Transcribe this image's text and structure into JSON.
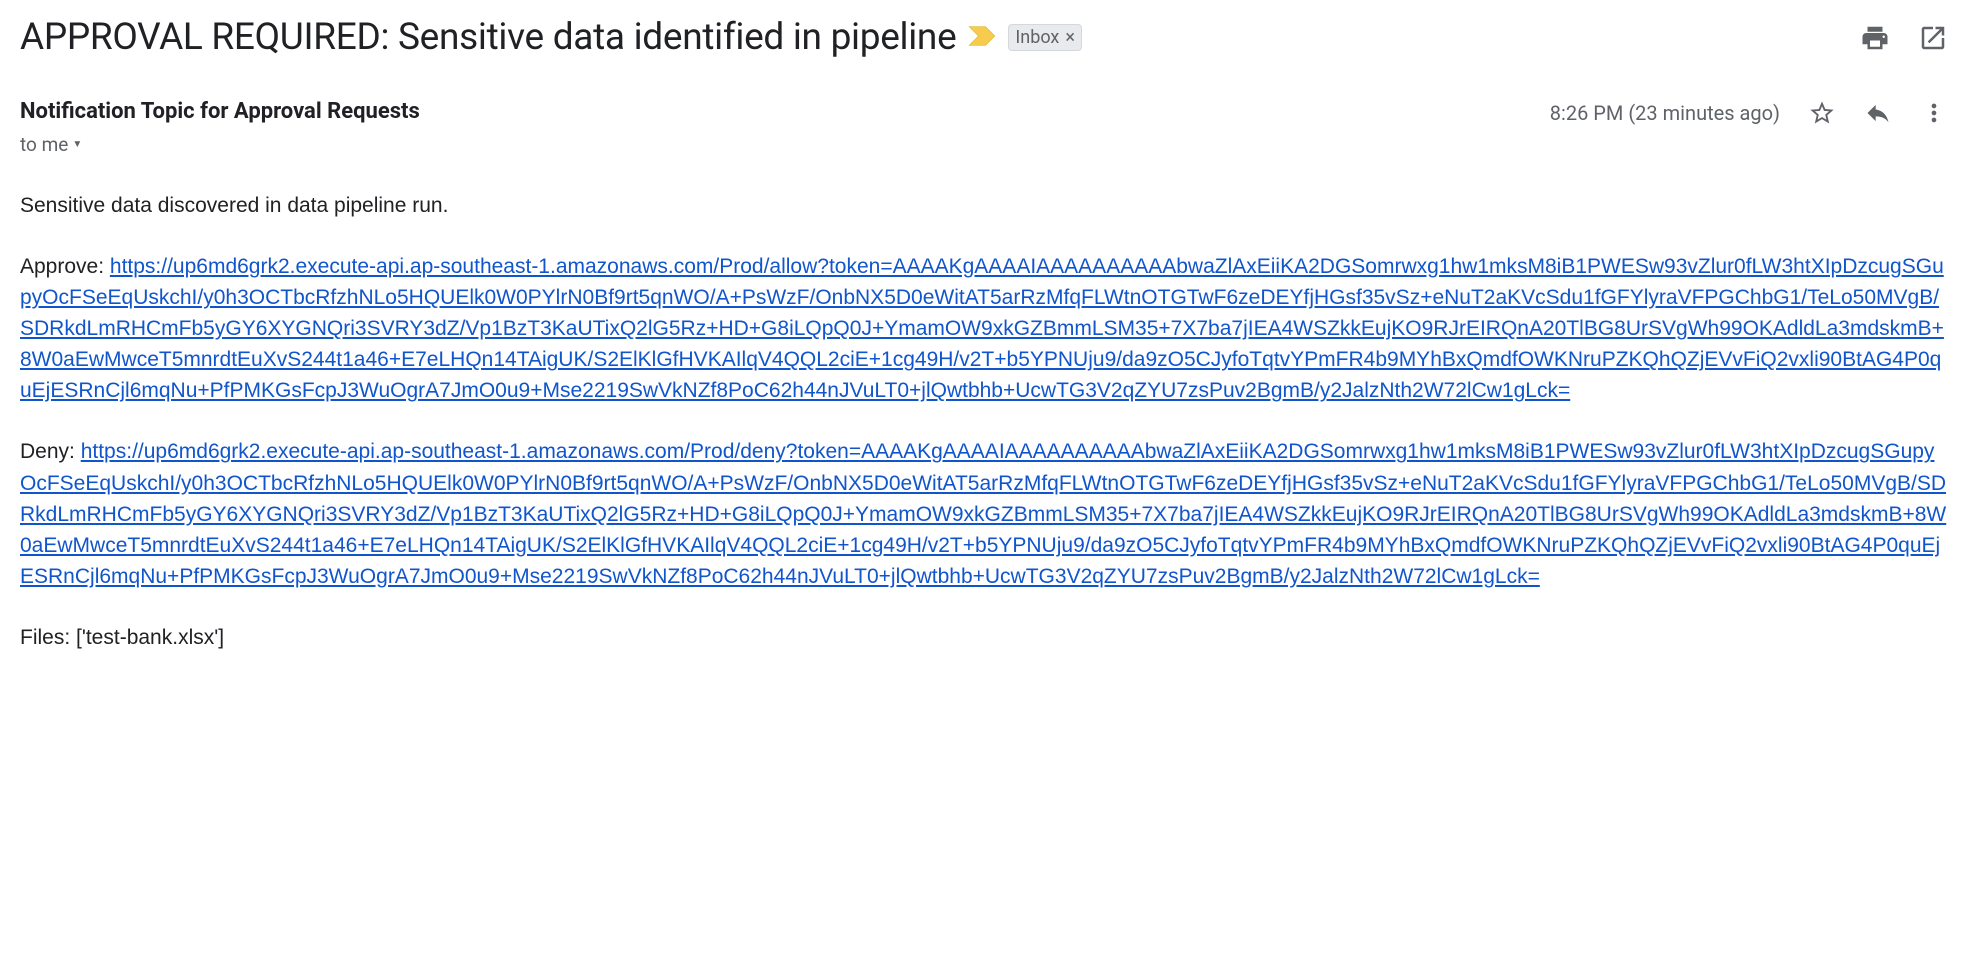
{
  "header": {
    "subject": "APPROVAL REQUIRED: Sensitive data identified in pipeline",
    "inbox_label": "Inbox"
  },
  "meta": {
    "sender": "Notification Topic for Approval Requests",
    "timestamp": "8:26 PM (23 minutes ago)",
    "to_line": "to me"
  },
  "body": {
    "intro": "Sensitive data discovered in data pipeline run.",
    "approve_label": "Approve: ",
    "approve_url": "https://up6md6grk2.execute-api.ap-southeast-1.amazonaws.com/Prod/allow?token=AAAAKgAAAAIAAAAAAAAAAbwaZlAxEiiKA2DGSomrwxg1hw1mksM8iB1PWESw93vZlur0fLW3htXIpDzcugSGupyOcFSeEqUskchI/y0h3OCTbcRfzhNLo5HQUElk0W0PYlrN0Bf9rt5qnWO/A+PsWzF/OnbNX5D0eWitAT5arRzMfqFLWtnOTGTwF6zeDEYfjHGsf35vSz+eNuT2aKVcSdu1fGFYlyraVFPGChbG1/TeLo50MVgB/SDRkdLmRHCmFb5yGY6XYGNQri3SVRY3dZ/Vp1BzT3KaUTixQ2lG5Rz+HD+G8iLQpQ0J+YmamOW9xkGZBmmLSM35+7X7ba7jIEA4WSZkkEujKO9RJrEIRQnA20TlBG8UrSVgWh99OKAdldLa3mdskmB+8W0aEwMwceT5mnrdtEuXvS244t1a46+E7eLHQn14TAigUK/S2ElKlGfHVKAIlqV4QQL2ciE+1cg49H/v2T+b5YPNUju9/da9zO5CJyfoTqtvYPmFR4b9MYhBxQmdfOWKNruPZKQhQZjEVvFiQ2vxli90BtAG4P0quEjESRnCjl6mqNu+PfPMKGsFcpJ3WuOgrA7JmO0u9+Mse2219SwVkNZf8PoC62h44nJVuLT0+jlQwtbhb+UcwTG3V2qZYU7zsPuv2BgmB/y2JalzNth2W72lCw1gLck=",
    "deny_label": "Deny: ",
    "deny_url": "https://up6md6grk2.execute-api.ap-southeast-1.amazonaws.com/Prod/deny?token=AAAAKgAAAAIAAAAAAAAAAbwaZlAxEiiKA2DGSomrwxg1hw1mksM8iB1PWESw93vZlur0fLW3htXIpDzcugSGupyOcFSeEqUskchI/y0h3OCTbcRfzhNLo5HQUElk0W0PYlrN0Bf9rt5qnWO/A+PsWzF/OnbNX5D0eWitAT5arRzMfqFLWtnOTGTwF6zeDEYfjHGsf35vSz+eNuT2aKVcSdu1fGFYlyraVFPGChbG1/TeLo50MVgB/SDRkdLmRHCmFb5yGY6XYGNQri3SVRY3dZ/Vp1BzT3KaUTixQ2lG5Rz+HD+G8iLQpQ0J+YmamOW9xkGZBmmLSM35+7X7ba7jIEA4WSZkkEujKO9RJrEIRQnA20TlBG8UrSVgWh99OKAdldLa3mdskmB+8W0aEwMwceT5mnrdtEuXvS244t1a46+E7eLHQn14TAigUK/S2ElKlGfHVKAIlqV4QQL2ciE+1cg49H/v2T+b5YPNUju9/da9zO5CJyfoTqtvYPmFR4b9MYhBxQmdfOWKNruPZKQhQZjEVvFiQ2vxli90BtAG4P0quEjESRnCjl6mqNu+PfPMKGsFcpJ3WuOgrA7JmO0u9+Mse2219SwVkNZf8PoC62h44nJVuLT0+jlQwtbhb+UcwTG3V2qZYU7zsPuv2BgmB/y2JalzNth2W72lCw1gLck=",
    "files": "Files: ['test-bank.xlsx']"
  }
}
